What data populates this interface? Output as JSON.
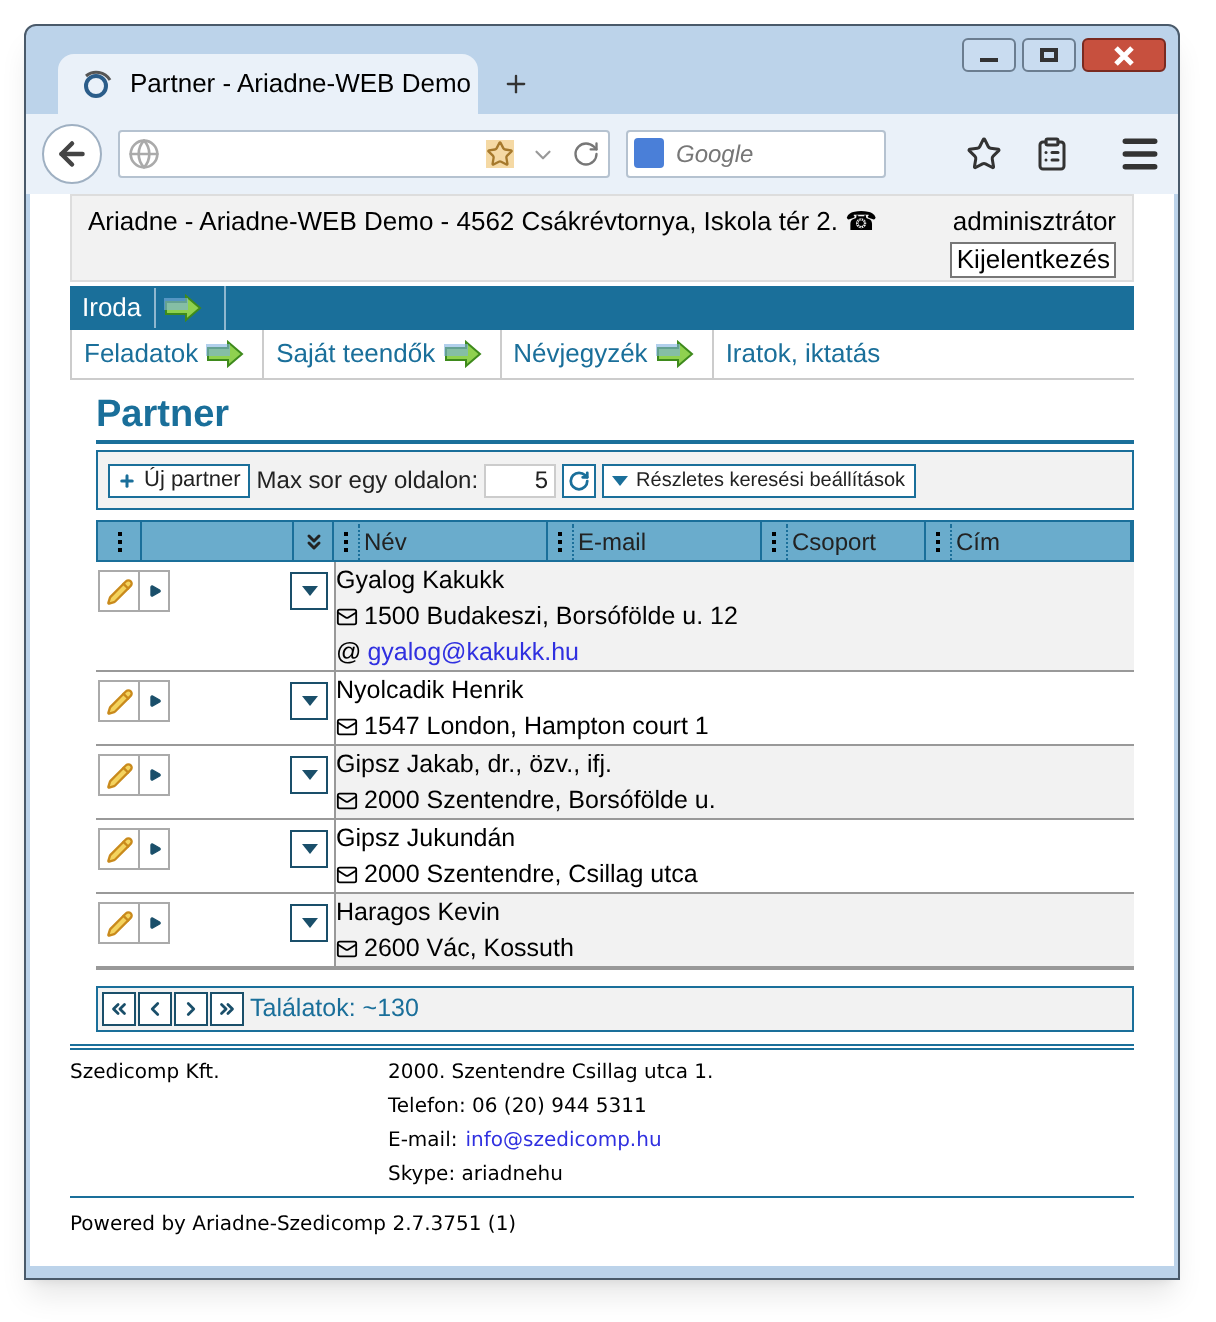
{
  "browser": {
    "tab_title": "Partner - Ariadne-WEB Demo",
    "search_placeholder": "Google"
  },
  "header": {
    "site": "Ariadne -  Ariadne-WEB Demo - 4562 Csákrévtornya, Iskola tér 2. ☎",
    "user": "adminisztrátor",
    "logout": "Kijelentkezés"
  },
  "menu": [
    {
      "label": "Iroda"
    }
  ],
  "submenu": [
    {
      "label": "Feladatok"
    },
    {
      "label": "Saját teendők"
    },
    {
      "label": "Névjegyzék"
    },
    {
      "label": "Iratok, iktatás"
    }
  ],
  "page_title": "Partner",
  "toolbar": {
    "new_button": "Új partner",
    "page_size_label": "Max sor egy oldalon:",
    "page_size": "5",
    "search_settings": "Részletes keresési beállítások"
  },
  "columns": [
    "Név",
    "E-mail",
    "Csoport",
    "Cím"
  ],
  "rows": [
    {
      "name": "Gyalog Kakukk",
      "lines": [
        {
          "kind": "address",
          "text": "1500 Budakeszi, Borsófölde u. 12"
        },
        {
          "kind": "email",
          "symbol": "@",
          "text": "gyalog@kakukk.hu"
        }
      ]
    },
    {
      "name": "Nyolcadik Henrik",
      "lines": [
        {
          "kind": "address",
          "text": "1547 London, Hampton court 1"
        }
      ]
    },
    {
      "name": "Gipsz Jakab, dr., özv., ifj.",
      "lines": [
        {
          "kind": "address",
          "text": "2000 Szentendre, Borsófölde u."
        }
      ]
    },
    {
      "name": "Gipsz Jukundán",
      "lines": [
        {
          "kind": "address",
          "text": "2000 Szentendre, Csillag utca"
        }
      ]
    },
    {
      "name": "Haragos Kevin",
      "lines": [
        {
          "kind": "address",
          "text": "2600 Vác, Kossuth"
        }
      ]
    }
  ],
  "pager": {
    "results": "Találatok: ~130"
  },
  "footer": {
    "company": "Szedicomp Kft.",
    "lines": [
      {
        "kind": "text",
        "text": "2000. Szentendre Csillag utca 1."
      },
      {
        "kind": "text",
        "text": "Telefon: 06 (20) 944 5311"
      },
      {
        "kind": "link",
        "label": "E-mail:",
        "text": "info@szedicomp.hu"
      },
      {
        "kind": "text",
        "text": "Skype: ariadnehu"
      }
    ],
    "powered": "Powered by Ariadne-Szedicomp 2.7.3751 (1)"
  }
}
